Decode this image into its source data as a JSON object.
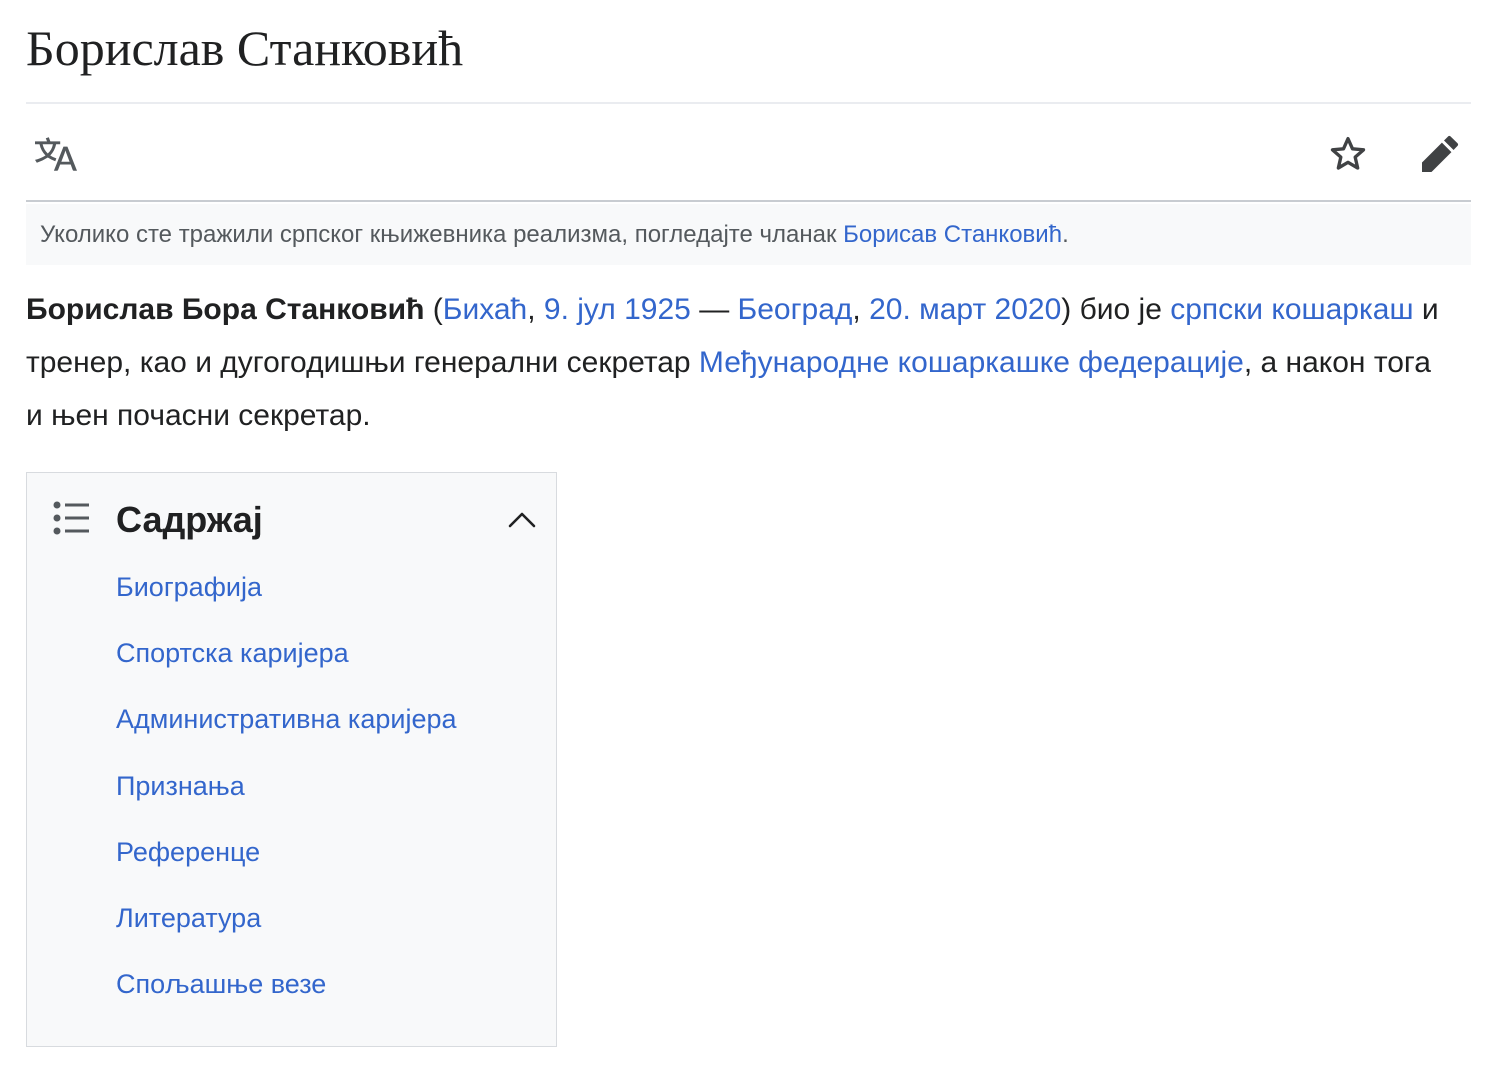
{
  "page": {
    "title": "Борислав Станковић"
  },
  "toolbar": {
    "language_icon": "translate-icon",
    "watch_icon": "star-icon",
    "edit_icon": "pencil-icon"
  },
  "hatnote": {
    "text": "Уколико сте тражили српског књижевника реализма, погледајте чланак ",
    "link": "Борисав Станковић",
    "end": "."
  },
  "lead": {
    "bold_name": "Борислав Бора Станковић",
    "open_paren": " (",
    "birth_place": "Бихаћ",
    "comma1": ", ",
    "birth_date": "9. јул 1925",
    "dash": " — ",
    "death_place": "Београд",
    "comma2": ", ",
    "death_date": "20. март 2020",
    "after_dates": ") био је ",
    "link_player": "српски кошаркаш",
    "mid_text": " и тренер, као и дугогодишњи генерални секретар ",
    "link_fiba": "Међународне кошаркашке федерације",
    "end_text": ", а након тога и њен почасни секретар."
  },
  "toc": {
    "title": "Садржај",
    "list_icon": "list-bullet-icon",
    "toggle_icon": "chevron-up-icon",
    "items": [
      {
        "label": "Биографија"
      },
      {
        "label": "Спортска каријера"
      },
      {
        "label": "Административна каријера"
      },
      {
        "label": "Признања"
      },
      {
        "label": "Референце"
      },
      {
        "label": "Литература"
      },
      {
        "label": "Спољашње везе"
      }
    ]
  },
  "colors": {
    "link": "#3366cc",
    "text": "#202122",
    "muted": "#54595d",
    "panel_bg": "#f8f9fa",
    "border": "#c8ccd1"
  }
}
